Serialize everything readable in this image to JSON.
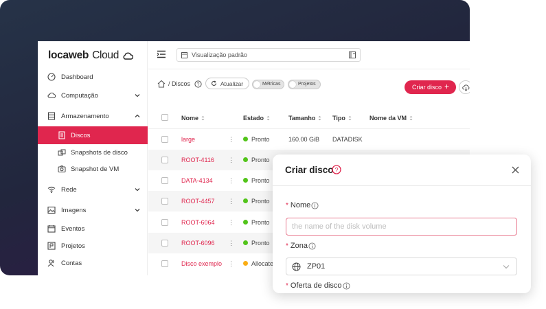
{
  "brand": {
    "logo_bold": "locaweb",
    "logo_light": "Cloud",
    "accent": "#e0264e"
  },
  "sidebar": {
    "items": [
      {
        "label": "Dashboard",
        "icon": "gauge-icon"
      },
      {
        "label": "Computação",
        "icon": "cloud-icon"
      },
      {
        "label": "Armazenamento",
        "icon": "storage-icon"
      },
      {
        "label": "Discos",
        "icon": "disk-icon"
      },
      {
        "label": "Snapshots de disco",
        "icon": "snapshot-disk-icon"
      },
      {
        "label": "Snapshot de VM",
        "icon": "camera-icon"
      },
      {
        "label": "Rede",
        "icon": "wifi-icon"
      },
      {
        "label": "Imagens",
        "icon": "image-icon"
      },
      {
        "label": "Eventos",
        "icon": "calendar-icon"
      },
      {
        "label": "Projetos",
        "icon": "projects-icon"
      },
      {
        "label": "Contas",
        "icon": "users-icon"
      }
    ]
  },
  "topbar": {
    "view_label": "Visualização padrão"
  },
  "toolbar": {
    "breadcrumb": "/  Discos",
    "refresh_label": "Atualizar",
    "metrics_label": "Métricas",
    "projects_label": "Projetos",
    "create_label": "Criar disco",
    "create_plus": "+"
  },
  "table": {
    "columns": [
      "Nome",
      "Estado",
      "Tamanho",
      "Tipo",
      "Nome da VM"
    ],
    "row_menu": "⋮",
    "rows": [
      {
        "name": "large",
        "state": "Pronto",
        "state_color": "#52c41a",
        "size": "160.00 GiB",
        "type": "DATADISK"
      },
      {
        "name": "ROOT-4116",
        "state": "Pronto",
        "state_color": "#52c41a",
        "size": "",
        "type": ""
      },
      {
        "name": "DATA-4134",
        "state": "Pronto",
        "state_color": "#52c41a",
        "size": "",
        "type": ""
      },
      {
        "name": "ROOT-4457",
        "state": "Pronto",
        "state_color": "#52c41a",
        "size": "",
        "type": ""
      },
      {
        "name": "ROOT-6064",
        "state": "Pronto",
        "state_color": "#52c41a",
        "size": "",
        "type": ""
      },
      {
        "name": "ROOT-6096",
        "state": "Pronto",
        "state_color": "#52c41a",
        "size": "",
        "type": ""
      },
      {
        "name": "Disco exemplo",
        "state": "Allocate",
        "state_color": "#faad14",
        "size": "",
        "type": ""
      }
    ]
  },
  "modal": {
    "title": "Criar disco",
    "name_label": "Nome",
    "name_placeholder": "the name of the disk volume",
    "zone_label": "Zona",
    "zone_value": "ZP01",
    "offer_label": "Oferta de disco",
    "required_mark": "*"
  }
}
